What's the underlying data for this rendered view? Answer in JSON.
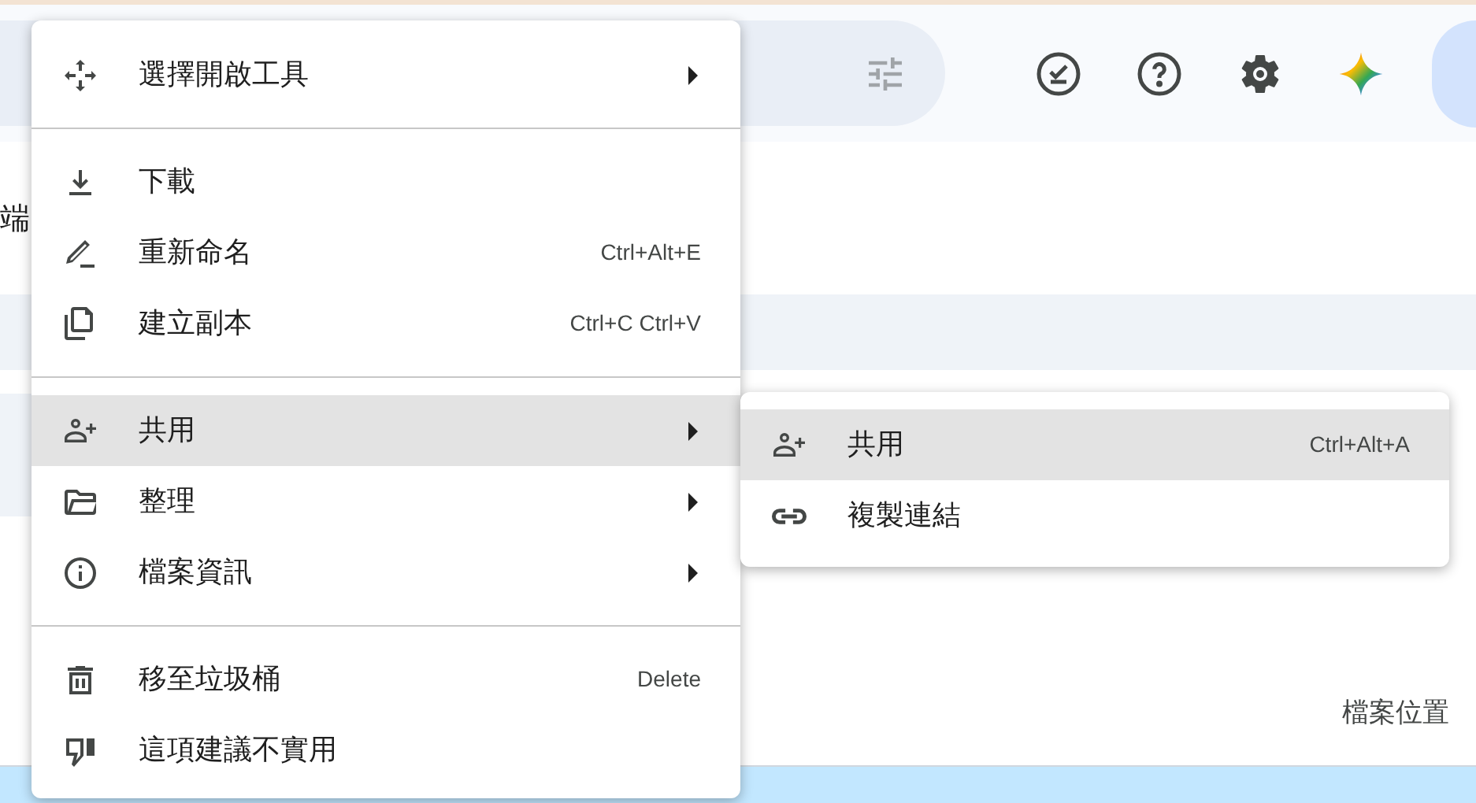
{
  "background": {
    "heading_fragment": "端",
    "column_header": "檔案位置"
  },
  "menu": {
    "groups": [
      [
        {
          "label": "選擇開啟工具",
          "submenu": true,
          "selected": false
        }
      ],
      [
        {
          "label": "下載",
          "submenu": false,
          "selected": false
        },
        {
          "label": "重新命名",
          "shortcut": "Ctrl+Alt+E",
          "submenu": false,
          "selected": false
        },
        {
          "label": "建立副本",
          "shortcut": "Ctrl+C Ctrl+V",
          "submenu": false,
          "selected": false
        }
      ],
      [
        {
          "label": "共用",
          "submenu": true,
          "selected": true
        },
        {
          "label": "整理",
          "submenu": true,
          "selected": false
        },
        {
          "label": "檔案資訊",
          "submenu": true,
          "selected": false
        }
      ],
      [
        {
          "label": "移至垃圾桶",
          "shortcut": "Delete",
          "submenu": false,
          "selected": false
        },
        {
          "label": "這項建議不實用",
          "submenu": false,
          "selected": false
        }
      ]
    ]
  },
  "submenu": {
    "items": [
      {
        "label": "共用",
        "shortcut": "Ctrl+Alt+A",
        "selected": true
      },
      {
        "label": "複製連結",
        "selected": false
      }
    ]
  }
}
